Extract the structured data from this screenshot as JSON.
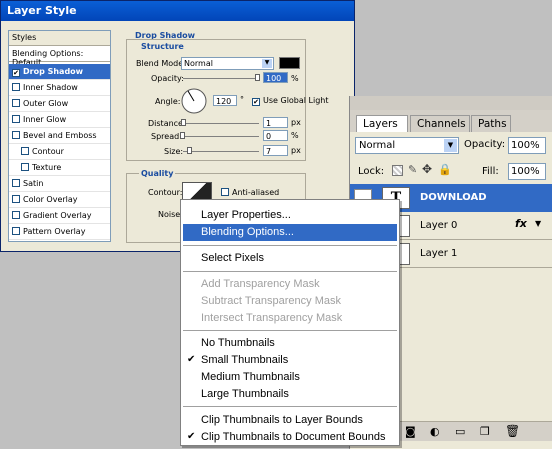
{
  "layer_style": {
    "title": "Layer Style",
    "styles_header": "Styles",
    "blending_options": "Blending Options: Default",
    "items": [
      {
        "label": "Drop Shadow",
        "checked": true
      },
      {
        "label": "Inner Shadow"
      },
      {
        "label": "Outer Glow"
      },
      {
        "label": "Inner Glow"
      },
      {
        "label": "Bevel and Emboss"
      },
      {
        "label": "Contour"
      },
      {
        "label": "Texture"
      },
      {
        "label": "Satin"
      },
      {
        "label": "Color Overlay"
      },
      {
        "label": "Gradient Overlay"
      },
      {
        "label": "Pattern Overlay"
      }
    ],
    "drop_shadow": {
      "group_title": "Drop Shadow",
      "structure_title": "Structure",
      "blend_mode_label": "Blend Mode:",
      "blend_mode_value": "Normal",
      "shadow_color": "#000000",
      "opacity_label": "Opacity:",
      "opacity_value": "100",
      "percent": "%",
      "angle_label": "Angle:",
      "angle_value": "120",
      "degree": "°",
      "use_global_light": "Use Global Light",
      "distance_label": "Distance:",
      "distance_value": "1",
      "spread_label": "Spread:",
      "spread_value": "0",
      "size_label": "Size:",
      "size_value": "7",
      "px": "px"
    },
    "quality": {
      "title": "Quality",
      "contour_label": "Contour:",
      "anti_aliased": "Anti-aliased",
      "noise_label": "Noise:"
    }
  },
  "layers_panel": {
    "tabs": [
      "Layers",
      "Channels",
      "Paths"
    ],
    "blend_mode": "Normal",
    "opacity_label": "Opacity:",
    "opacity_value": "100%",
    "lock_label": "Lock:",
    "fill_label": "Fill:",
    "fill_value": "100%",
    "layers": [
      {
        "name": "DOWNLOAD",
        "thumb": "T"
      },
      {
        "name": "Layer 0",
        "fx": "fx"
      },
      {
        "name": "Layer 1"
      }
    ]
  },
  "context_menu": {
    "items": [
      {
        "label": "Layer Properties..."
      },
      {
        "label": "Blending Options..."
      },
      {
        "label": "Select Pixels"
      },
      {
        "label": "Add Transparency Mask"
      },
      {
        "label": "Subtract Transparency Mask"
      },
      {
        "label": "Intersect Transparency Mask"
      },
      {
        "label": "No Thumbnails"
      },
      {
        "label": "Small Thumbnails"
      },
      {
        "label": "Medium Thumbnails"
      },
      {
        "label": "Large Thumbnails"
      },
      {
        "label": "Clip Thumbnails to Layer Bounds"
      },
      {
        "label": "Clip Thumbnails to Document Bounds"
      }
    ],
    "check": "✔"
  },
  "colors": {
    "highlight": "#316ac5",
    "title_bar": "#0a5fd6",
    "disabled_text": "#a0a0a0"
  }
}
